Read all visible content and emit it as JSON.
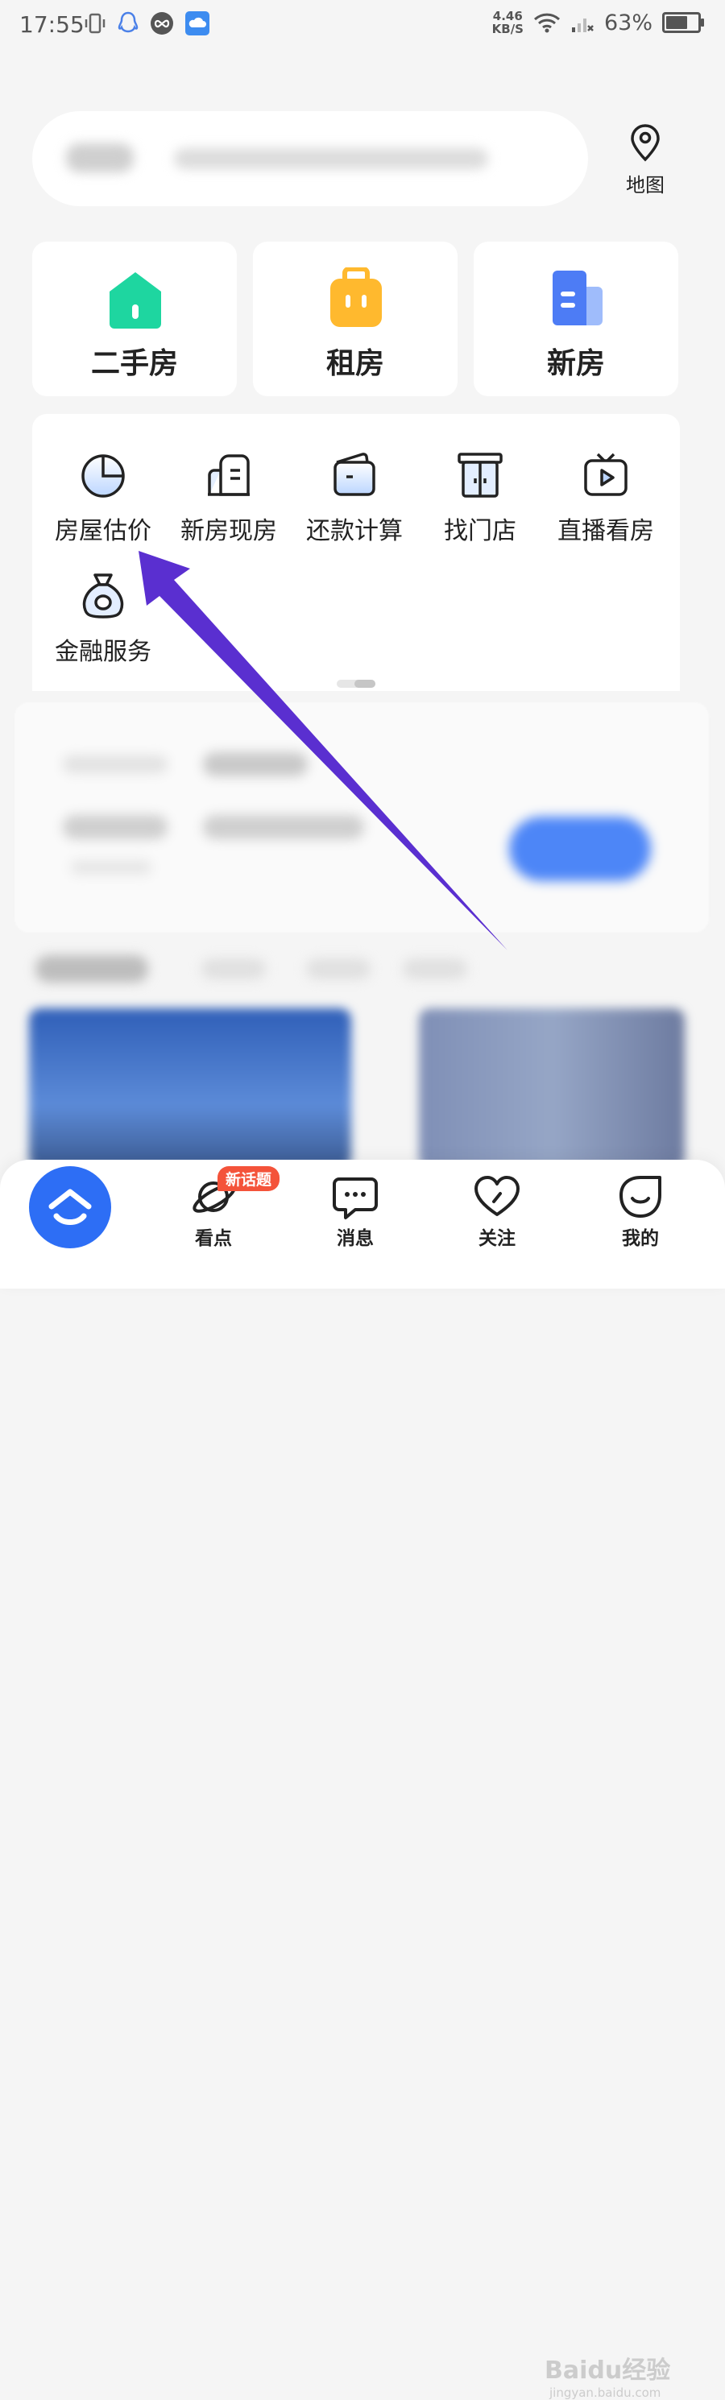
{
  "status_bar": {
    "time": "17:55",
    "net_speed_value": "4.46",
    "net_speed_unit": "KB/S",
    "battery": "63%",
    "battery_level": 0.63
  },
  "search": {
    "map_label": "地图"
  },
  "categories": [
    {
      "label": "二手房",
      "color": "#1ed6a0"
    },
    {
      "label": "租房",
      "color": "#ffb92e"
    },
    {
      "label": "新房",
      "color": "#4d7cf5"
    }
  ],
  "tools": [
    {
      "label": "房屋估价",
      "icon": "pie-chart-icon"
    },
    {
      "label": "新房现房",
      "icon": "building-icon"
    },
    {
      "label": "还款计算",
      "icon": "wallet-icon"
    },
    {
      "label": "找门店",
      "icon": "store-icon"
    },
    {
      "label": "直播看房",
      "icon": "tv-play-icon"
    },
    {
      "label": "金融服务",
      "icon": "money-bag-icon"
    }
  ],
  "annotation": {
    "color": "#5a2fd0"
  },
  "bottom_nav": {
    "items": [
      {
        "label": "看点",
        "icon": "planet-icon"
      },
      {
        "label": "消息",
        "icon": "chat-icon"
      },
      {
        "label": "关注",
        "icon": "heart-icon"
      },
      {
        "label": "我的",
        "icon": "profile-icon"
      }
    ],
    "badge": "新话题",
    "home_color": "#2d6ef5"
  },
  "watermark": {
    "brand": "Baidu经验",
    "sub": "jingyan.baidu.com"
  }
}
